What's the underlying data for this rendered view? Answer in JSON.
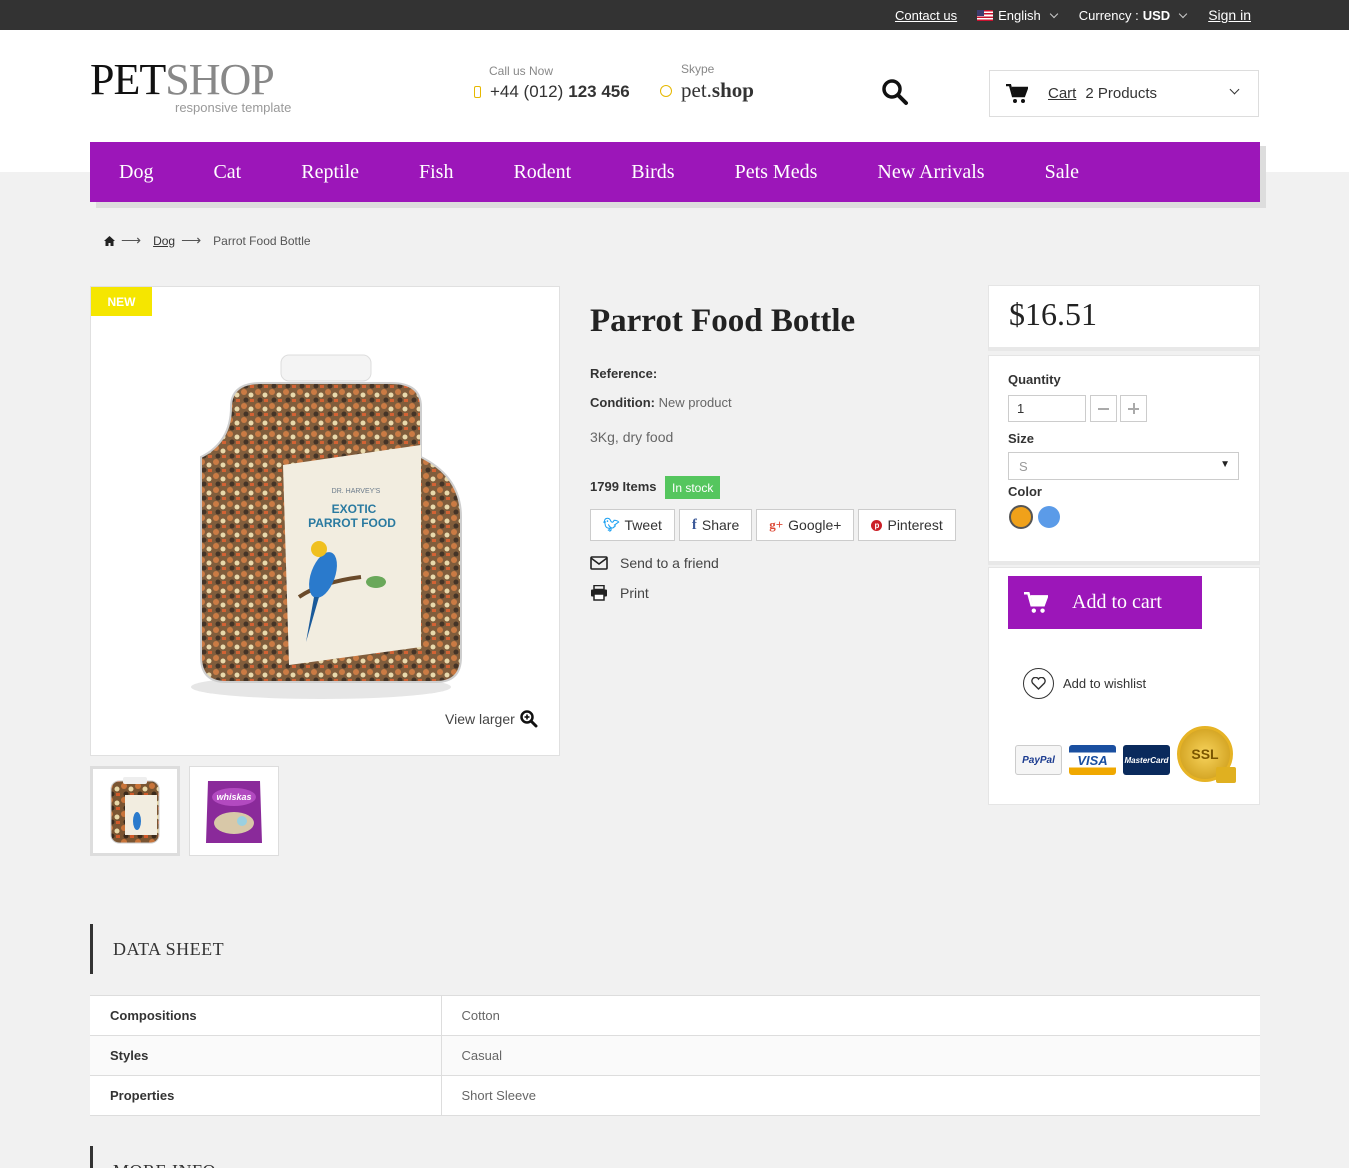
{
  "topbar": {
    "contact": "Contact us",
    "language": "English",
    "currency_label": "Currency :",
    "currency_value": "USD",
    "sign_in": "Sign in"
  },
  "header": {
    "logo_bold": "PET",
    "logo_light": "SHOP",
    "logo_sub": "responsive template",
    "call_label": "Call us Now",
    "call_prefix": "+44 (012)",
    "call_number": "123 456",
    "skype_label": "Skype",
    "skype_prefix": "pet.",
    "skype_name": "shop",
    "cart_label": "Cart",
    "cart_count": "2 Products"
  },
  "nav": [
    "Dog",
    "Cat",
    "Reptile",
    "Fish",
    "Rodent",
    "Birds",
    "Pets Meds",
    "New Arrivals",
    "Sale"
  ],
  "breadcrumb": {
    "category": "Dog",
    "current": "Parrot Food Bottle"
  },
  "product": {
    "badge": "NEW",
    "view_larger": "View larger",
    "title": "Parrot Food Bottle",
    "reference_label": "Reference:",
    "condition_label": "Condition:",
    "condition_value": "New product",
    "description": "3Kg, dry food",
    "quantity_available": "1799 Items",
    "stock_status": "In stock",
    "share": {
      "tweet": "Tweet",
      "share": "Share",
      "google": "Google+",
      "pinterest": "Pinterest"
    },
    "send_friend": "Send to a friend",
    "print": "Print",
    "bottle_label_top": "DR. HARVEY'S",
    "bottle_label_main": "EXOTIC",
    "bottle_label_main2": "PARROT FOOD",
    "thumb2_label": "whiskas"
  },
  "buy": {
    "price": "$16.51",
    "quantity_label": "Quantity",
    "quantity_value": "1",
    "size_label": "Size",
    "size_value": "S",
    "color_label": "Color",
    "colors": [
      "#f0a11a",
      "#5b9be8"
    ],
    "add_to_cart": "Add to cart",
    "wishlist": "Add to wishlist",
    "payments": {
      "paypal": "PayPal",
      "visa": "VISA",
      "mastercard": "MasterCard",
      "ssl": "SSL"
    }
  },
  "datasheet": {
    "title": "DATA SHEET",
    "rows": [
      {
        "key": "Compositions",
        "value": "Cotton"
      },
      {
        "key": "Styles",
        "value": "Casual"
      },
      {
        "key": "Properties",
        "value": "Short Sleeve"
      }
    ]
  },
  "more_info_title": "MORE INFO",
  "colors": {
    "accent": "#9c16b9",
    "topbar": "#333333",
    "badge": "#f5e600",
    "stock": "#55c65e"
  }
}
